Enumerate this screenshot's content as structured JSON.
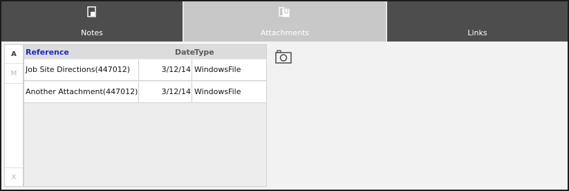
{
  "tabs": [
    {
      "label": "Notes",
      "icon": "notes-icon",
      "active": false
    },
    {
      "label": "Attachments",
      "icon": "attachments-icon",
      "active": true
    },
    {
      "label": "Links",
      "icon": "",
      "active": false
    }
  ],
  "alpha_index": {
    "top": "A",
    "middle": "M",
    "bottom": "X"
  },
  "table": {
    "headers": {
      "reference": "Reference",
      "date": "Date",
      "type": "Type"
    },
    "rows": [
      {
        "reference": "Job Site Directions(447012)",
        "date": "3/12/14",
        "type": "WindowsFile"
      },
      {
        "reference": "Another Attachment(447012)",
        "date": "3/12/14",
        "type": "WindowsFile"
      }
    ]
  },
  "actions": {
    "camera_icon": "camera-icon"
  },
  "colors": {
    "tab_bar": "#4d4d4d",
    "active_tab": "#c8c8c8",
    "header_link": "#2323c8",
    "background": "#f2f2f2"
  }
}
